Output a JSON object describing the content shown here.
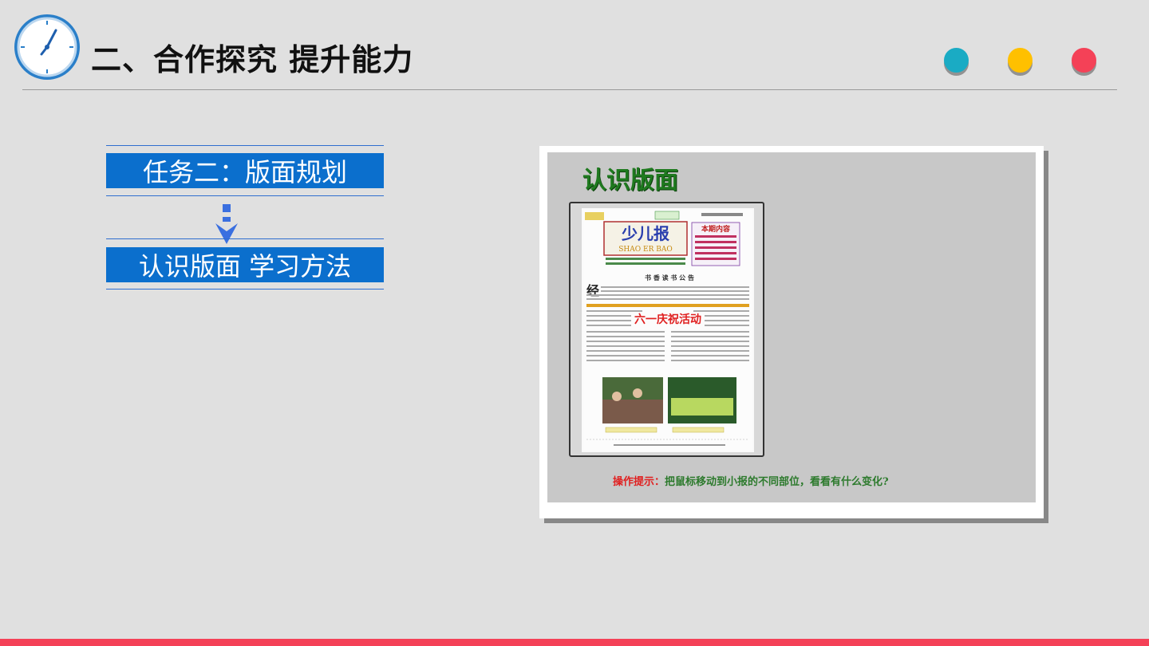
{
  "header": {
    "title": "二、合作探究  提升能力",
    "clock_icon": "clock-icon",
    "dots": [
      "#1aabc4",
      "#ffc000",
      "#f44157"
    ]
  },
  "tasks": [
    {
      "label": "任务二：版面规划"
    },
    {
      "label": "认识版面 学习方法"
    }
  ],
  "flow_arrow_icon": "arrow-down-icon",
  "screenshot": {
    "title": "认识版面",
    "newspaper": {
      "name": "少儿报",
      "pinyin": "SHAO  ER  BAO",
      "contents_title": "本期内容",
      "headline": "六一庆祝活动",
      "section_title": "书 香 读 书 公 告",
      "first_char": "经"
    },
    "hint_prefix": "操作提示：",
    "hint_text": "把鼠标移动到小报的不同部位，看看有什么变化?"
  },
  "colors": {
    "background": "#e0e0e0",
    "task_blue": "#0b6fcd",
    "accent_red": "#f44157",
    "hint_green": "#2c7a2c"
  }
}
